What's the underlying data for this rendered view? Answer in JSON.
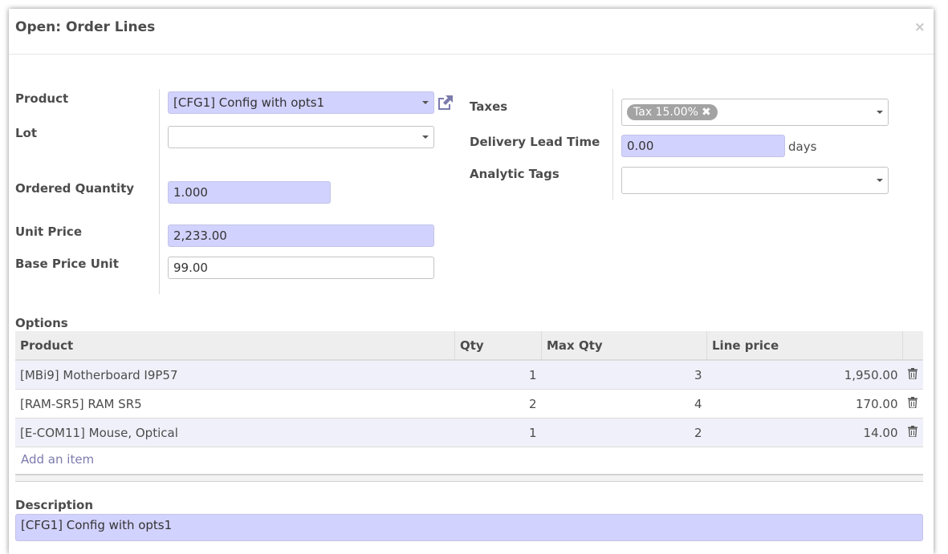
{
  "dialog": {
    "title": "Open: Order Lines",
    "close_glyph": "×"
  },
  "left_form": {
    "product": {
      "label": "Product",
      "value": "[CFG1] Config with opts1"
    },
    "lot": {
      "label": "Lot",
      "value": ""
    },
    "ordered_quantity": {
      "label": "Ordered Quantity",
      "value": "1.000"
    },
    "unit_price": {
      "label": "Unit Price",
      "value": "2,233.00"
    },
    "base_price_unit": {
      "label": "Base Price Unit",
      "value": "99.00"
    }
  },
  "right_form": {
    "taxes": {
      "label": "Taxes",
      "tag": "Tax 15.00%",
      "tag_remove": "✖"
    },
    "delivery_lead_time": {
      "label": "Delivery Lead Time",
      "value": "0.00",
      "suffix": "days"
    },
    "analytic_tags": {
      "label": "Analytic Tags",
      "value": ""
    }
  },
  "options": {
    "section_label": "Options",
    "columns": [
      "Product",
      "Qty",
      "Max Qty",
      "Line price"
    ],
    "rows": [
      {
        "product": "[MBi9] Motherboard I9P57",
        "qty": "1",
        "max_qty": "3",
        "line_price": "1,950.00"
      },
      {
        "product": "[RAM-SR5] RAM SR5",
        "qty": "2",
        "max_qty": "4",
        "line_price": "170.00"
      },
      {
        "product": "[E-COM11] Mouse, Optical",
        "qty": "1",
        "max_qty": "2",
        "line_price": "14.00"
      }
    ],
    "add_item": "Add an item"
  },
  "description": {
    "label": "Description",
    "value": "[CFG1] Config with opts1"
  },
  "colors": {
    "required_field": "#d2d2ff",
    "link": "#7c7bad",
    "tag": "#a3a3a3"
  },
  "icons": {
    "external_link": "external-link-icon",
    "trash": "trash-icon",
    "dropdown": "caret-down-icon"
  }
}
